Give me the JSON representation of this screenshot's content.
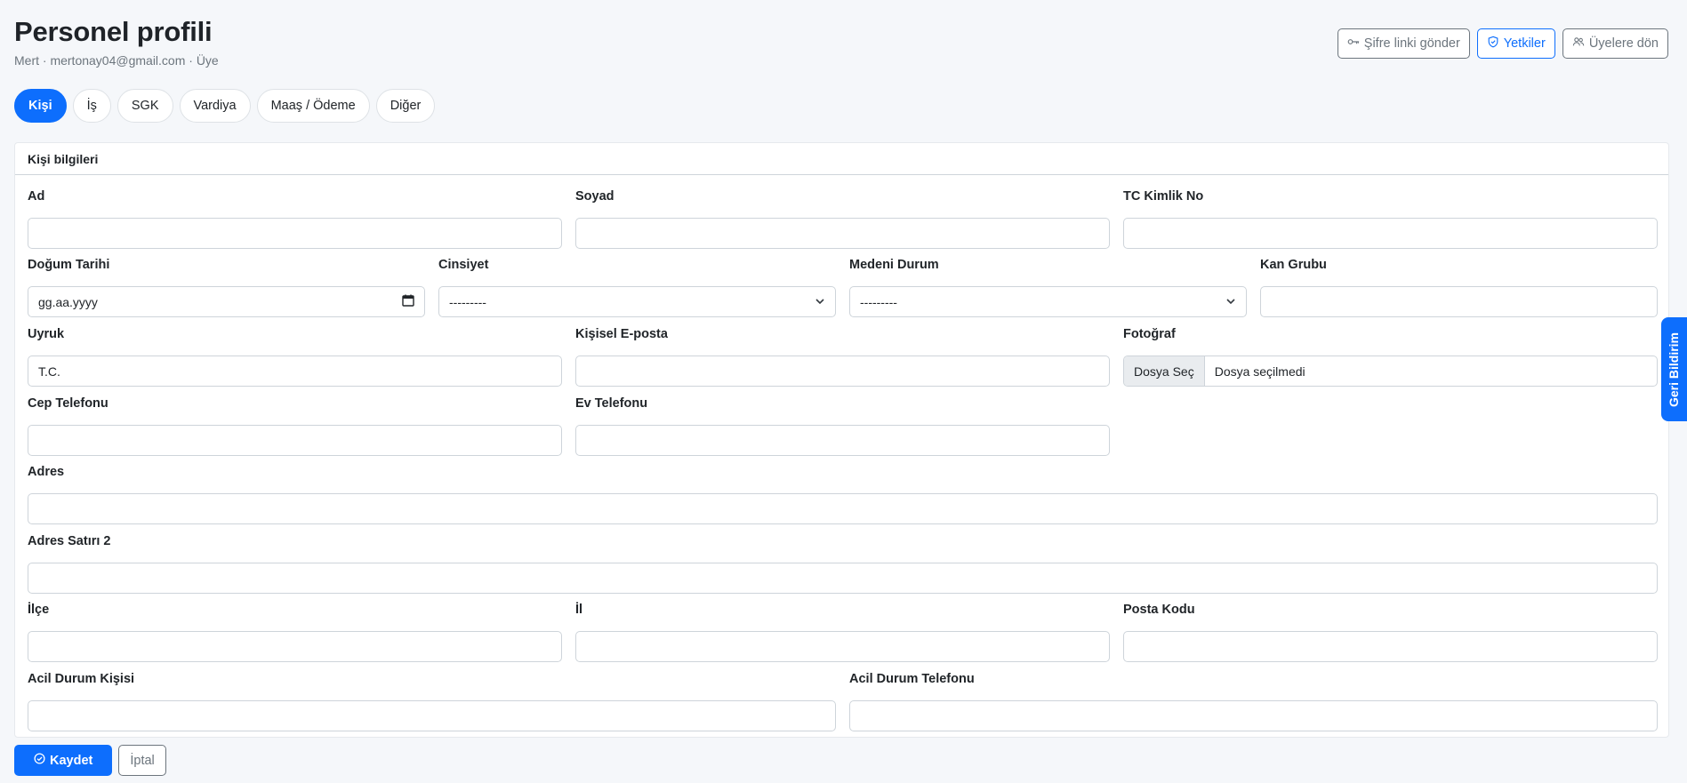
{
  "header": {
    "title": "Personel profili",
    "subtitle": "Mert · mertonay04@gmail.com · Üye",
    "actions": {
      "send_password": "Şifre linki gönder",
      "permissions": "Yetkiler",
      "back_to_members": "Üyelere dön"
    }
  },
  "tabs": [
    {
      "label": "Kişi",
      "active": true
    },
    {
      "label": "İş"
    },
    {
      "label": "SGK"
    },
    {
      "label": "Vardiya"
    },
    {
      "label": "Maaş / Ödeme"
    },
    {
      "label": "Diğer"
    }
  ],
  "card": {
    "title": "Kişi bilgileri",
    "fields": {
      "ad": {
        "label": "Ad",
        "value": ""
      },
      "soyad": {
        "label": "Soyad",
        "value": ""
      },
      "tc": {
        "label": "TC Kimlik No",
        "value": ""
      },
      "dogum": {
        "label": "Doğum Tarihi",
        "value": "gg.aa.yyyy"
      },
      "cinsiyet": {
        "label": "Cinsiyet",
        "value": "---------"
      },
      "medeni": {
        "label": "Medeni Durum",
        "value": "---------"
      },
      "kan": {
        "label": "Kan Grubu",
        "value": ""
      },
      "uyruk": {
        "label": "Uyruk",
        "value": "T.C."
      },
      "eposta": {
        "label": "Kişisel E-posta",
        "value": ""
      },
      "foto": {
        "label": "Fotoğraf",
        "button": "Dosya Seç",
        "status": "Dosya seçilmedi"
      },
      "cep": {
        "label": "Cep Telefonu",
        "value": ""
      },
      "ev": {
        "label": "Ev Telefonu",
        "value": ""
      },
      "adres": {
        "label": "Adres",
        "value": ""
      },
      "adres2": {
        "label": "Adres Satırı 2",
        "value": ""
      },
      "ilce": {
        "label": "İlçe",
        "value": ""
      },
      "il": {
        "label": "İl",
        "value": ""
      },
      "posta": {
        "label": "Posta Kodu",
        "value": ""
      },
      "acil_kisi": {
        "label": "Acil Durum Kişisi",
        "value": ""
      },
      "acil_tel": {
        "label": "Acil Durum Telefonu",
        "value": ""
      }
    }
  },
  "footer": {
    "save": "Kaydet",
    "cancel": "İptal"
  },
  "feedback_tab": "Geri Bildirim",
  "colors": {
    "primary": "#0d6efd",
    "secondary": "#6c757d",
    "background": "#f5f7fa"
  }
}
